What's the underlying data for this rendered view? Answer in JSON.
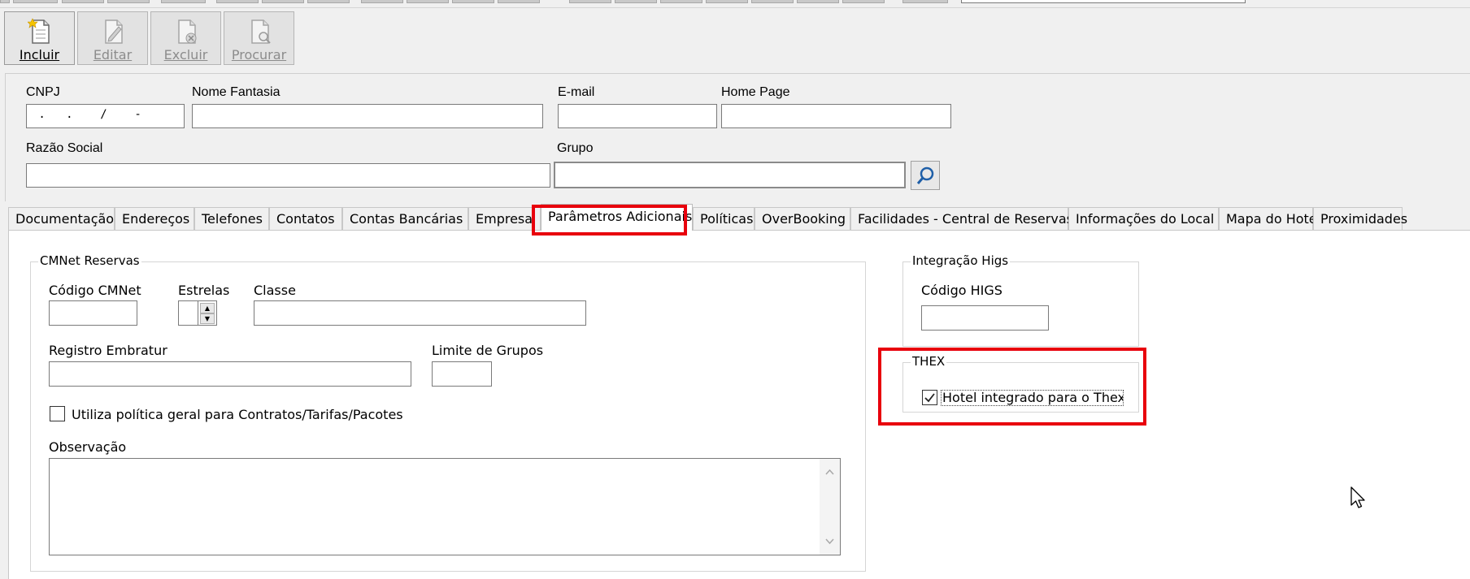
{
  "toolbar": {
    "incluir": "Incluir",
    "editar": "Editar",
    "excluir": "Excluir",
    "procurar": "Procurar"
  },
  "header": {
    "cnpj_label": "CNPJ",
    "cnpj_mask": " .   .    /    -",
    "nome_fantasia_label": "Nome Fantasia",
    "email_label": "E-mail",
    "home_page_label": "Home Page",
    "razao_social_label": "Razão Social",
    "grupo_label": "Grupo"
  },
  "tabs": [
    "Documentação",
    "Endereços",
    "Telefones",
    "Contatos",
    "Contas Bancárias",
    "Empresa",
    "Parâmetros Adicionais",
    "Políticas",
    "OverBooking",
    "Facilidades - Central de Reservas",
    "Informações do Local",
    "Mapa do Hotel",
    "Proximidades"
  ],
  "active_tab": "Parâmetros Adicionais",
  "cmnet": {
    "title": "CMNet Reservas",
    "codigo_label": "Código CMNet",
    "estrelas_label": "Estrelas",
    "classe_label": "Classe",
    "registro_label": "Registro Embratur",
    "limite_label": "Limite de Grupos",
    "politica_label": "Utiliza política geral para Contratos/Tarifas/Pacotes",
    "politica_checked": false,
    "observacao_label": "Observação"
  },
  "higs": {
    "title": "Integração Higs",
    "codigo_label": "Código HIGS"
  },
  "thex": {
    "title": "THEX",
    "checkbox_label": "Hotel integrado para o Thex",
    "checked": true
  },
  "colors": {
    "highlight": "#e8000c",
    "window_bg": "#f0f0f0",
    "panel_bg": "#ffffff"
  }
}
